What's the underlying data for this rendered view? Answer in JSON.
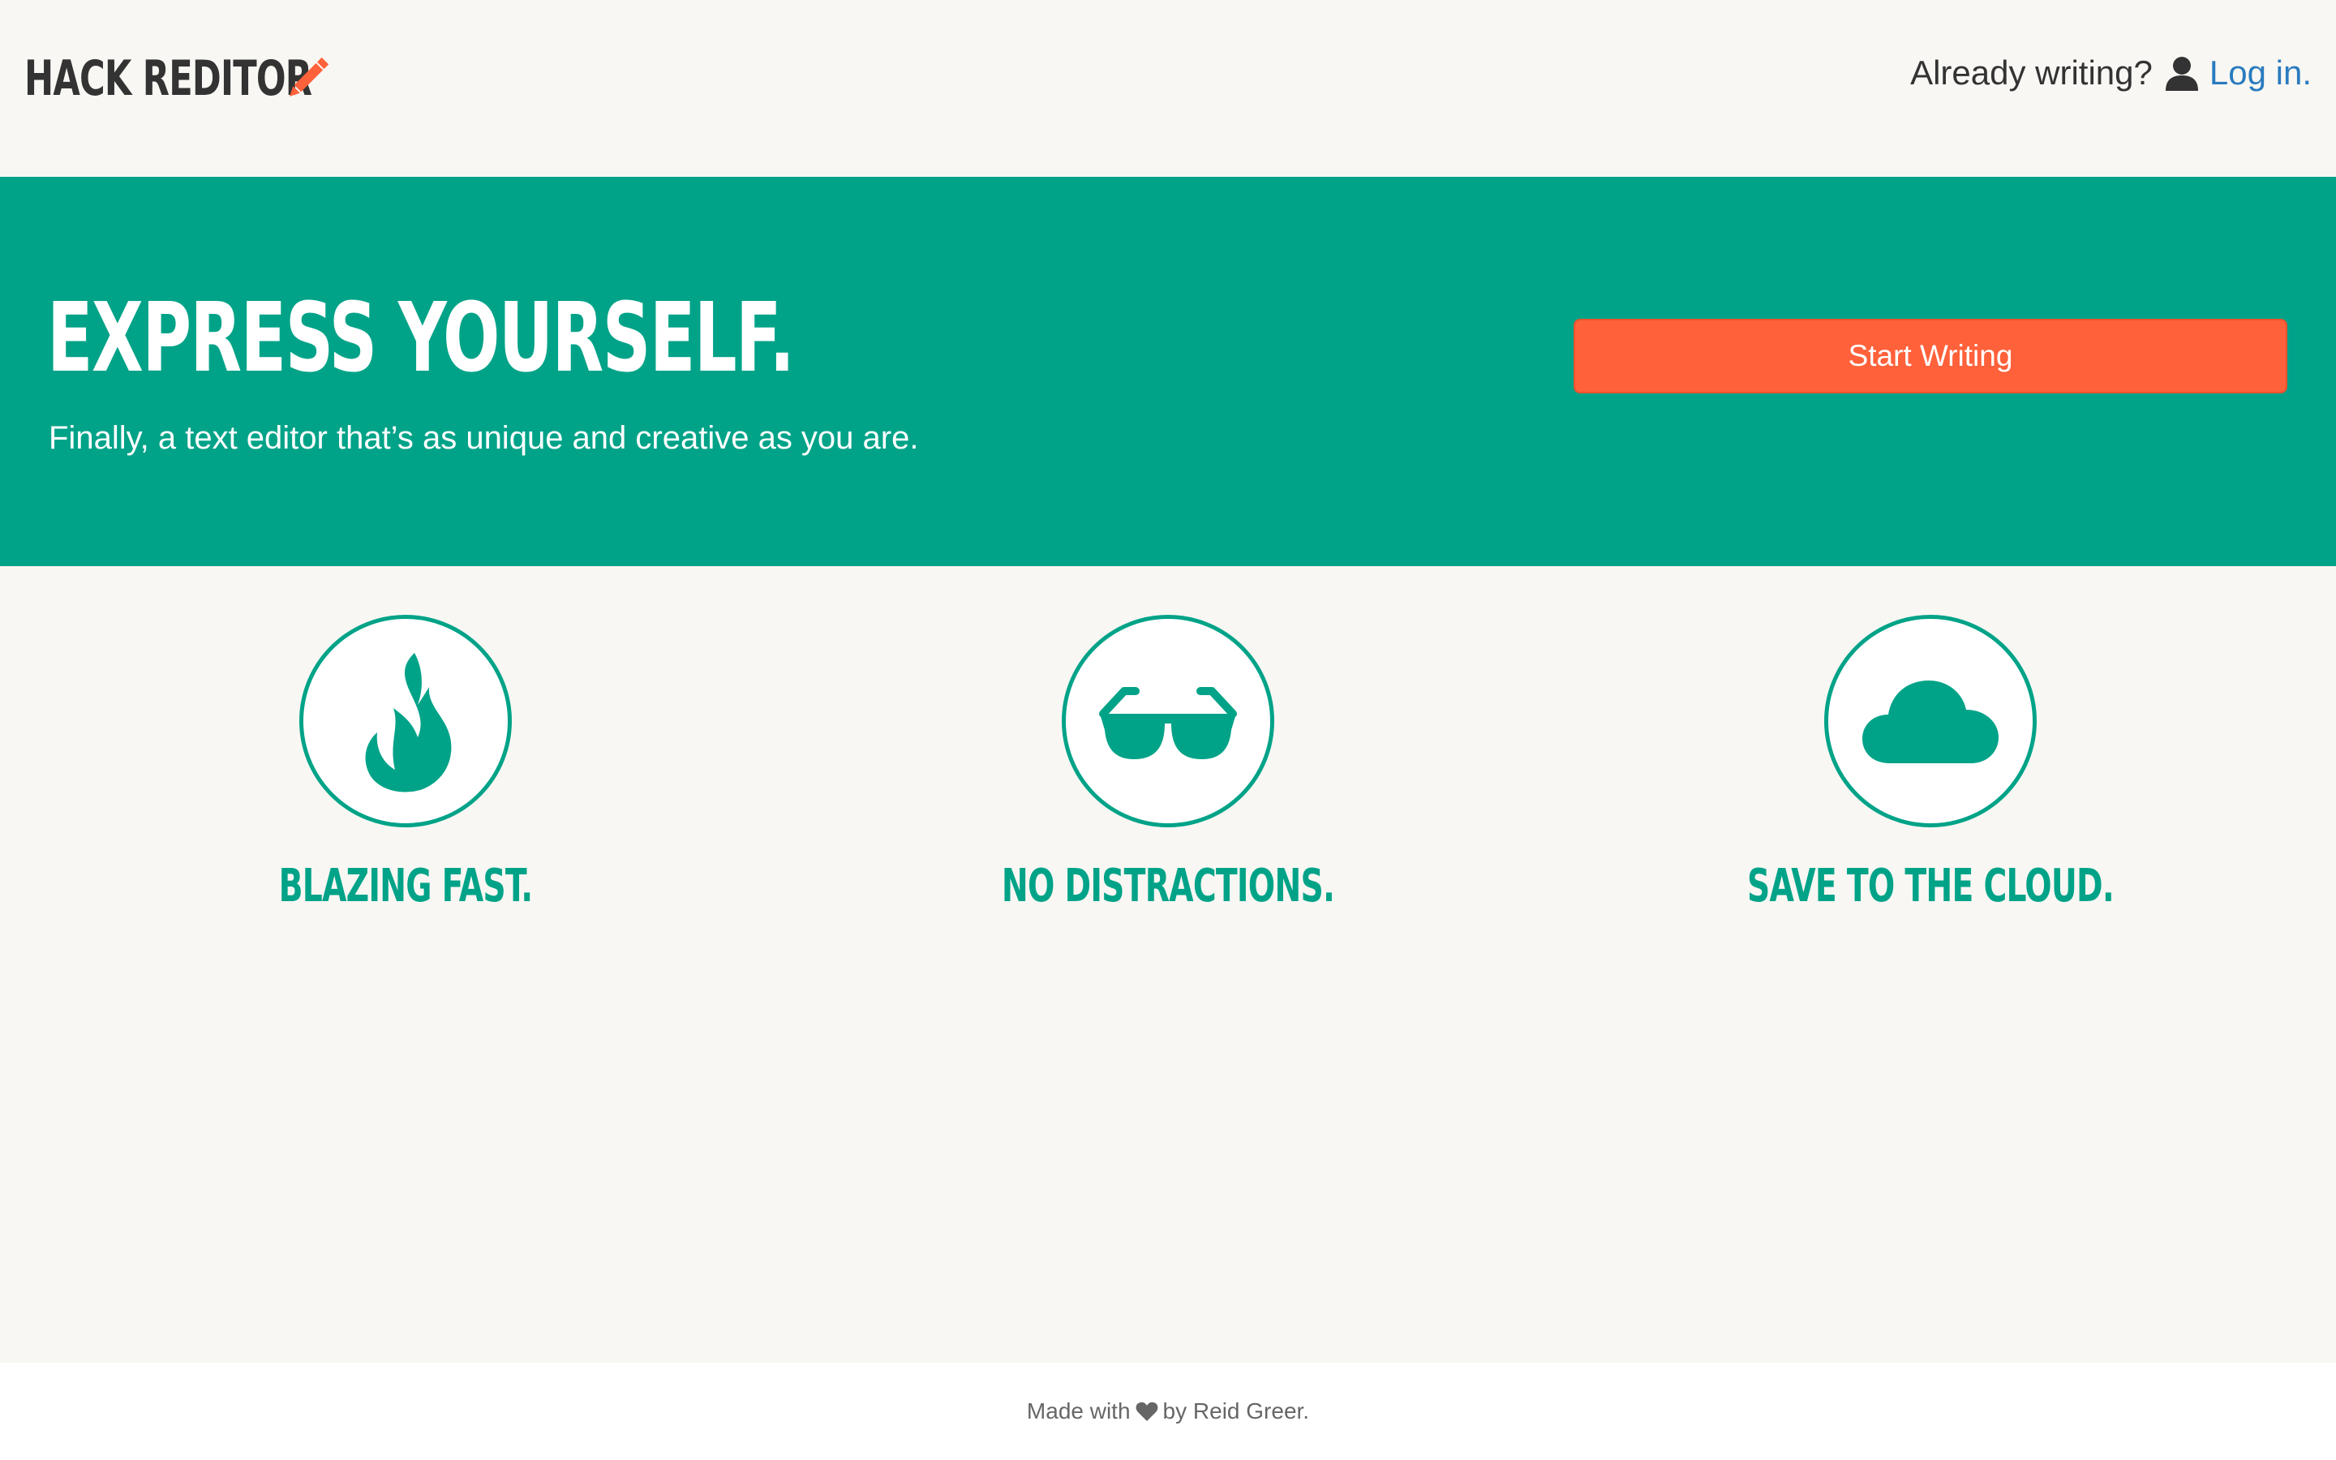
{
  "header": {
    "logo_text": "HACK REDITOR",
    "logo_icon": "pencil-icon",
    "login_prompt": "Already writing?",
    "login_icon": "user-icon",
    "login_link": "Log in."
  },
  "hero": {
    "title": "EXPRESS YOURSELF.",
    "subtitle": "Finally, a text editor that’s as unique and creative as you are.",
    "cta_label": "Start Writing"
  },
  "features": [
    {
      "icon": "flame-icon",
      "label": "BLAZING FAST."
    },
    {
      "icon": "sunglasses-icon",
      "label": "NO DISTRACTIONS."
    },
    {
      "icon": "cloud-icon",
      "label": "SAVE TO THE CLOUD."
    }
  ],
  "footer": {
    "made_with": "Made with",
    "heart_icon": "heart-icon",
    "by_text": "by Reid Greer."
  },
  "colors": {
    "brand_teal": "#00a388",
    "accent_orange": "#ff613a",
    "link_blue": "#2a7bbf",
    "page_background": "#f9f7f3",
    "footer_background": "#ffffff"
  }
}
